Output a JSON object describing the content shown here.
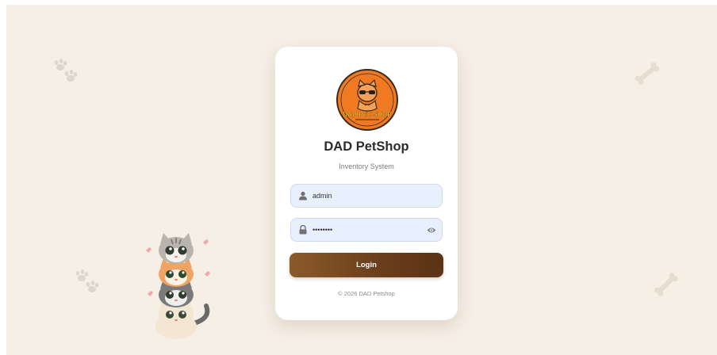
{
  "brand": {
    "title": "DAD PetShop",
    "subtitle": "Inventory System",
    "logo_text": "DAD PET SHOP",
    "logo_color": "#f07a22"
  },
  "form": {
    "username": {
      "value": "admin",
      "icon": "user-icon"
    },
    "password": {
      "value": "••••••••",
      "icon": "lock-icon",
      "toggle_icon": "eye-icon"
    },
    "login_label": "Login"
  },
  "footer": {
    "copyright": "© 2026 DAD Petshop"
  },
  "decorations": {
    "icons": [
      "paw-prints-icon",
      "bone-icon",
      "stacked-cats-illustration"
    ]
  },
  "colors": {
    "background": "#f6efe6",
    "card": "#ffffff",
    "input_bg": "#e8f0fe",
    "button_start": "#8a5a2b",
    "button_end": "#5a3215"
  }
}
